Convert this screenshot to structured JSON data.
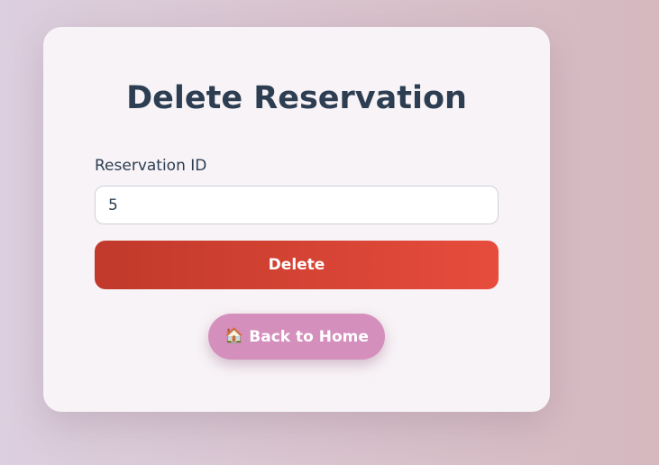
{
  "page": {
    "title": "Delete Reservation"
  },
  "form": {
    "reservation_id_label": "Reservation ID",
    "reservation_id_value": "5",
    "delete_label": "Delete"
  },
  "navigation": {
    "home_icon": "house-icon",
    "home_label": "Back to Home"
  },
  "colors": {
    "title": "#2d3e52",
    "delete_gradient_start": "#c0392b",
    "delete_gradient_end": "#e74c3c",
    "home_button": "#d48fbd"
  }
}
